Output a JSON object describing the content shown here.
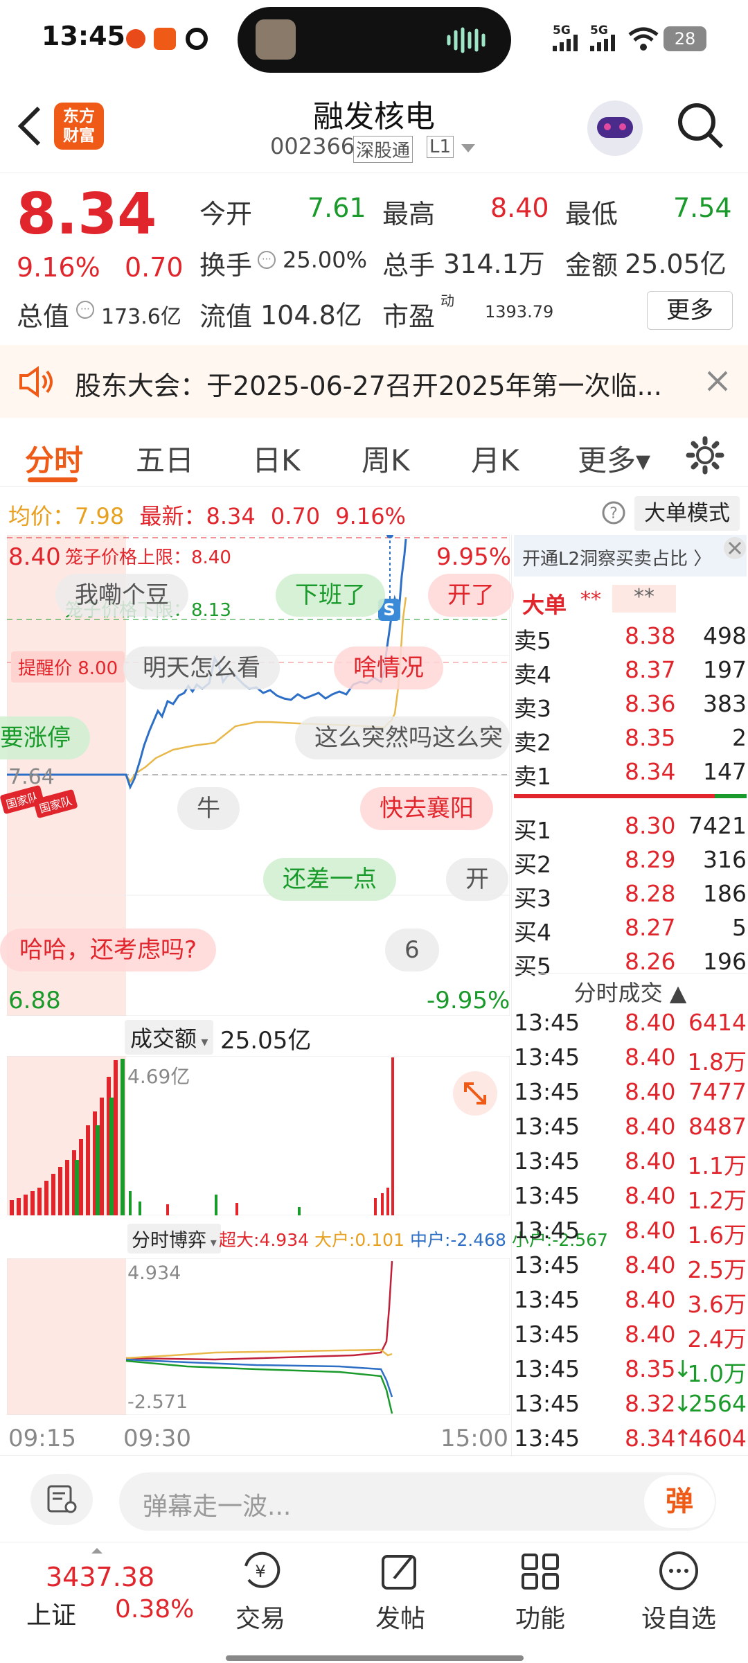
{
  "status_bar": {
    "time": "13:45",
    "battery": "28",
    "network1": "5G",
    "network2": "5G"
  },
  "header": {
    "logo": "东方\n财富",
    "logo_l1": "东方",
    "logo_l2": "财富",
    "stock_name": "融发核电",
    "stock_code": "002366",
    "tag1": "深股通",
    "tag2": "L1"
  },
  "quote": {
    "price": "8.34",
    "change_pct": "9.16%",
    "change": "0.70",
    "open_label": "今开",
    "open": "7.61",
    "high_label": "最高",
    "high": "8.40",
    "low_label": "最低",
    "low": "7.54",
    "turnover_label": "换手",
    "turnover": "25.00%",
    "volume_label": "总手",
    "volume": "314.1万",
    "amount_label": "金额",
    "amount": "25.05亿",
    "mcap_label": "总值",
    "mcap": "173.6亿",
    "float_label": "流值",
    "float": "104.8亿",
    "pe_label": "市盈",
    "pe_sup": "动",
    "pe": "1393.79",
    "more_button": "更多"
  },
  "notice": {
    "text": "股东大会：于2025-06-27召开2025年第一次临..."
  },
  "tabs": [
    {
      "label": "分时",
      "active": true
    },
    {
      "label": "五日"
    },
    {
      "label": "日K"
    },
    {
      "label": "周K"
    },
    {
      "label": "月K"
    },
    {
      "label": "更多▾"
    }
  ],
  "chart_info": {
    "avg_label": "均价：",
    "avg": "7.98",
    "latest_label": "最新：",
    "latest": "8.34",
    "chg": "0.70",
    "pct": "9.16%",
    "big_order_btn": "大单模式"
  },
  "chart": {
    "y_top": "8.40",
    "y_top_pct": "9.95%",
    "y_bottom": "6.88",
    "y_bottom_pct": "-9.95%",
    "ref_price": "7.64",
    "cage_upper": "笼子价格上限：8.40",
    "cage_lower": "笼子价格下限：8.13",
    "alert_price": "提醒价 8.00",
    "s_marker": "S",
    "flag_text": "国家队"
  },
  "danmaku": [
    {
      "text": "我嘞个豆",
      "style": "n"
    },
    {
      "text": "下班了",
      "style": "g"
    },
    {
      "text": "开了",
      "style": "r"
    },
    {
      "text": "明天怎么看",
      "style": "n"
    },
    {
      "text": "啥情况",
      "style": "r"
    },
    {
      "text": "要涨停",
      "style": "g"
    },
    {
      "text": "这么突然吗这么突",
      "style": "n"
    },
    {
      "text": "牛",
      "style": "n"
    },
    {
      "text": "快去襄阳",
      "style": "r"
    },
    {
      "text": "还差一点",
      "style": "g"
    },
    {
      "text": "开",
      "style": "n"
    },
    {
      "text": "哈哈，还考虑吗?",
      "style": "r"
    },
    {
      "text": "6",
      "style": "n"
    }
  ],
  "volume_panel": {
    "label": "成交额",
    "value": "25.05亿",
    "max": "4.69亿"
  },
  "flow_panel": {
    "label": "分时博弈",
    "super_label": "超大:",
    "super": "4.934",
    "big_label": "大户:",
    "big": "0.101",
    "mid_label": "中户:",
    "mid": "-2.468",
    "small_label": "小户:",
    "small": "-2.567",
    "max": "4.934",
    "min": "-2.571"
  },
  "time_axis": {
    "t1": "09:15",
    "t2": "09:30",
    "t3": "15:00"
  },
  "orderbook": {
    "l2_text": "开通L2洞察买卖占比 〉",
    "big_label": "大单",
    "stars1": "**",
    "stars2": "**",
    "asks": [
      {
        "label": "卖5",
        "price": "8.38",
        "vol": "498"
      },
      {
        "label": "卖4",
        "price": "8.37",
        "vol": "197"
      },
      {
        "label": "卖3",
        "price": "8.36",
        "vol": "383"
      },
      {
        "label": "卖2",
        "price": "8.35",
        "vol": "2"
      },
      {
        "label": "卖1",
        "price": "8.34",
        "vol": "147"
      }
    ],
    "bids": [
      {
        "label": "买1",
        "price": "8.30",
        "vol": "7421"
      },
      {
        "label": "买2",
        "price": "8.29",
        "vol": "316"
      },
      {
        "label": "买3",
        "price": "8.28",
        "vol": "186"
      },
      {
        "label": "买4",
        "price": "8.27",
        "vol": "5"
      },
      {
        "label": "买5",
        "price": "8.26",
        "vol": "196"
      }
    ]
  },
  "trades": {
    "title": "分时成交 ▲",
    "rows": [
      {
        "time": "13:45",
        "price": "8.40",
        "vol": "6414",
        "dir": ""
      },
      {
        "time": "13:45",
        "price": "8.40",
        "vol": "1.8万",
        "dir": ""
      },
      {
        "time": "13:45",
        "price": "8.40",
        "vol": "7477",
        "dir": ""
      },
      {
        "time": "13:45",
        "price": "8.40",
        "vol": "8487",
        "dir": ""
      },
      {
        "time": "13:45",
        "price": "8.40",
        "vol": "1.1万",
        "dir": ""
      },
      {
        "time": "13:45",
        "price": "8.40",
        "vol": "1.2万",
        "dir": ""
      },
      {
        "time": "13:45",
        "price": "8.40",
        "vol": "1.6万",
        "dir": ""
      },
      {
        "time": "13:45",
        "price": "8.40",
        "vol": "2.5万",
        "dir": ""
      },
      {
        "time": "13:45",
        "price": "8.40",
        "vol": "3.6万",
        "dir": ""
      },
      {
        "time": "13:45",
        "price": "8.40",
        "vol": "2.4万",
        "dir": ""
      },
      {
        "time": "13:45",
        "price": "8.35",
        "vol": "1.0万",
        "dir": "↓"
      },
      {
        "time": "13:45",
        "price": "8.32",
        "vol": "2564",
        "dir": "↓"
      },
      {
        "time": "13:45",
        "price": "8.34",
        "vol": "4604",
        "dir": "↑"
      }
    ]
  },
  "comment_bar": {
    "placeholder": "弹幕走一波...",
    "danmaku_btn": "弹"
  },
  "bottom_nav": {
    "index_value": "3437.38",
    "index_name": "上证",
    "index_pct": "0.38%",
    "trade": "交易",
    "post": "发帖",
    "features": "功能",
    "watchlist": "设自选"
  },
  "colors": {
    "up": "#e0262c",
    "down": "#1a9a2a",
    "brand": "#ef5b17",
    "avg_line": "#e8b84a",
    "price_line": "#2d6fc6"
  }
}
